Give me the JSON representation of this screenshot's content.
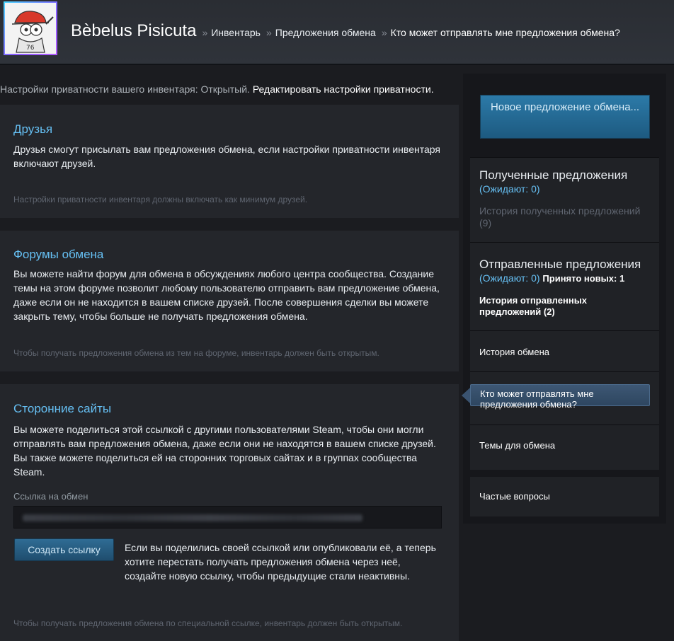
{
  "header": {
    "username": "Bèbelus Pisicuta",
    "breadcrumbs": [
      "Инвентарь",
      "Предложения обмена",
      "Кто может отправлять мне предложения обмена?"
    ],
    "separator": "»"
  },
  "privacy": {
    "text": "Настройки приватности вашего инвентаря: Открытый.",
    "edit_link": "Редактировать настройки приватности."
  },
  "friends": {
    "title": "Друзья",
    "description": "Друзья смогут присылать вам предложения обмена, если настройки приватности инвентаря включают друзей.",
    "note": "Настройки приватности инвентаря должны включать как минимум друзей."
  },
  "forums": {
    "title": "Форумы обмена",
    "description": "Вы можете найти форум для обмена в обсуждениях любого центра сообщества. Создание темы на этом форуме позволит любому пользователю отправить вам предложение обмена, даже если он не находится в вашем списке друзей. После совершения сделки вы можете закрыть тему, чтобы больше не получать предложения обмена.",
    "note": "Чтобы получать предложения обмена из тем на форуме, инвентарь должен быть открытым."
  },
  "third_party": {
    "title": "Сторонние сайты",
    "description": "Вы можете поделиться этой ссылкой с другими пользователями Steam, чтобы они могли отправлять вам предложения обмена, даже если они не находятся в вашем списке друзей. Вы также можете поделиться ей на сторонних торговых сайтах и в группах сообщества Steam.",
    "link_label": "Ссылка на обмен",
    "create_button": "Создать ссылку",
    "create_description": "Если вы поделились своей ссылкой или опубликовали её, а теперь хотите перестать получать предложения обмена через неё, создайте новую ссылку, чтобы предыдущие стали неактивны.",
    "note": "Чтобы получать предложения обмена по специальной ссылке, инвентарь должен быть открытым."
  },
  "sidebar": {
    "new_offer_button": "Новое предложение обмена...",
    "received": {
      "title": "Полученные предложения",
      "pending": "(Ожидают: 0)",
      "history": "История полученных предложений (9)"
    },
    "sent": {
      "title": "Отправленные предложения",
      "pending": "(Ожидают: 0)",
      "accepted": "Принято новых: 1",
      "history": "История отправленных предложений (2)"
    },
    "trade_history": "История обмена",
    "who_can_send": "Кто может отправлять мне предложения обмена?",
    "trade_topics": "Темы для обмена",
    "faq": "Частые вопросы"
  },
  "colors": {
    "accent_blue": "#66c0f4",
    "background": "#1b1c20",
    "panel": "#24262b"
  }
}
